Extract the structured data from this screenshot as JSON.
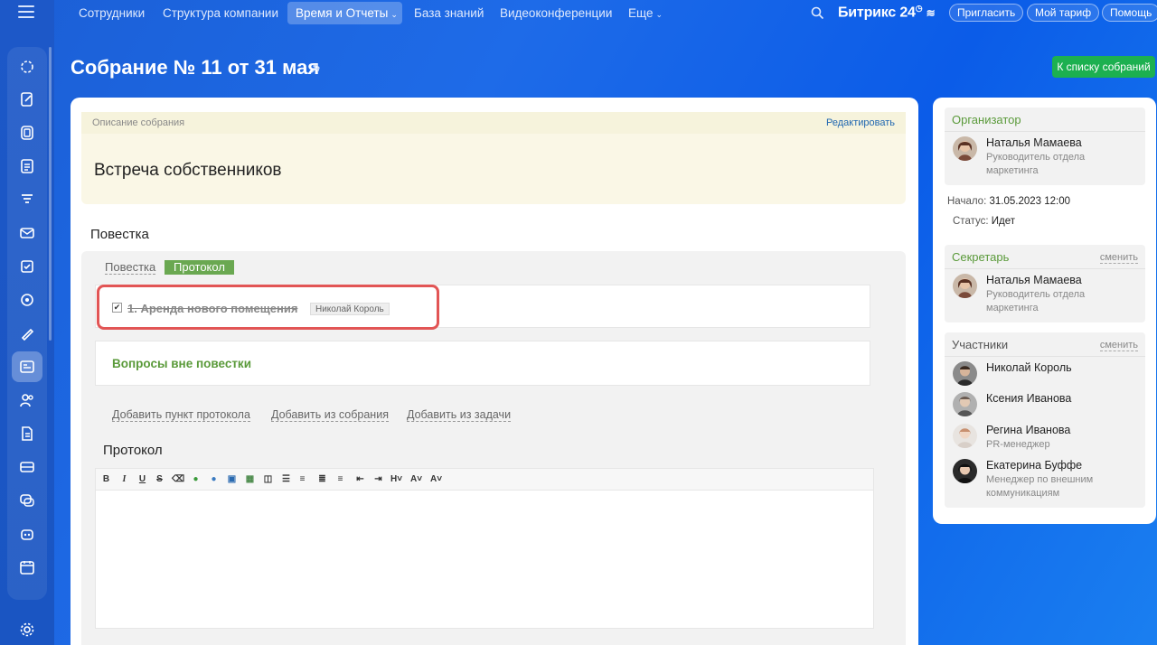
{
  "nav": {
    "items": [
      "Сотрудники",
      "Структура компании",
      "Время и Отчеты",
      "База знаний",
      "Видеоконференции",
      "Еще"
    ],
    "brand": "Битрикс 24",
    "invite": "Пригласить",
    "tariff": "Мой тариф",
    "help": "Помощь"
  },
  "page": {
    "title": "Собрание № 11 от 31 мая",
    "back_button": "К списку собраний"
  },
  "description": {
    "label": "Описание собрания",
    "edit": "Редактировать",
    "text": "Встреча собственников"
  },
  "agenda": {
    "title": "Повестка",
    "tab_agenda": "Повестка",
    "tab_protocol": "Протокол",
    "item_text": "1. Аренда нового помещения",
    "item_tag": "Николай Король",
    "outside": "Вопросы вне повестки",
    "add_protocol_item": "Добавить пункт протокола",
    "add_from_meeting": "Добавить из собрания",
    "add_from_task": "Добавить из задачи"
  },
  "protocol": {
    "title": "Протокол",
    "toolbar": [
      "B",
      "I",
      "U",
      "S"
    ]
  },
  "sidebar_right": {
    "organizer": {
      "title": "Организатор",
      "name": "Наталья Мамаева",
      "role": "Руководитель отдела маркетинга"
    },
    "start_label": "Начало:",
    "start_value": "31.05.2023 12:00",
    "status_label": "Статус:",
    "status_value": "Идет",
    "secretary": {
      "title": "Секретарь",
      "change": "сменить",
      "name": "Наталья Мамаева",
      "role": "Руководитель отдела маркетинга"
    },
    "participants": {
      "title": "Участники",
      "change": "сменить",
      "list": [
        {
          "name": "Николай Король",
          "role": ""
        },
        {
          "name": "Ксения Иванова",
          "role": ""
        },
        {
          "name": "Регина Иванова",
          "role": "PR-менеджер"
        },
        {
          "name": "Екатерина Буффе",
          "role": "Менеджер по внешним коммуникациям"
        }
      ]
    }
  },
  "colors": {
    "accent_green": "#1cb050",
    "highlight_red": "#e25555",
    "section_green": "#5a9a3a"
  }
}
